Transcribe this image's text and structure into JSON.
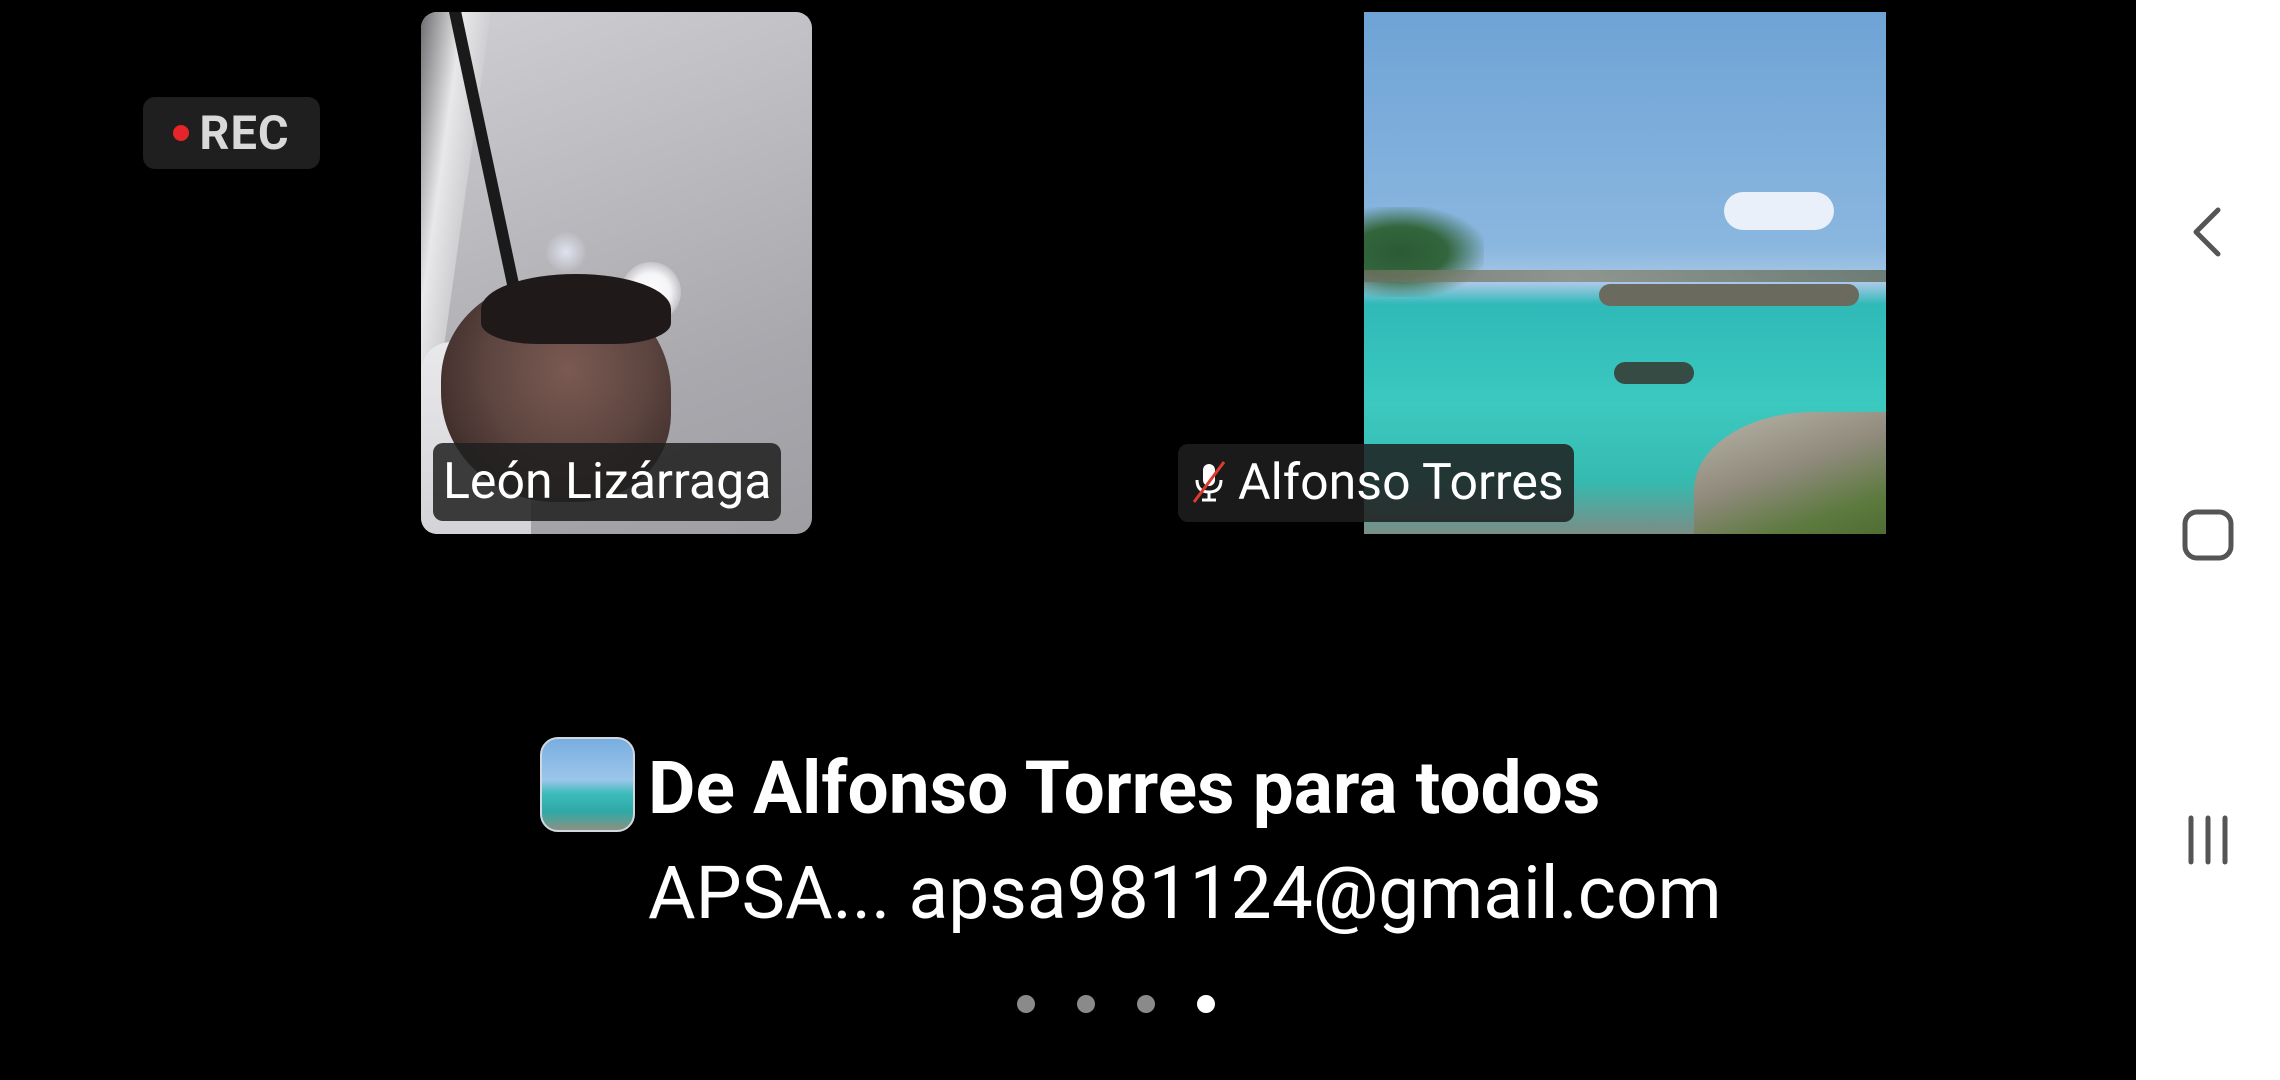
{
  "recording": {
    "label": "REC",
    "dot_color": "#e5252a"
  },
  "participants": [
    {
      "name": "León Lizárraga",
      "muted": false
    },
    {
      "name": "Alfonso Torres",
      "muted": true,
      "icon": "mic-muted-icon"
    }
  ],
  "chat_notification": {
    "title": "De Alfonso Torres para todos",
    "message": "APSA... apsa981124@gmail.com"
  },
  "pager": {
    "total": 4,
    "active_index": 3
  },
  "nav_bar": {
    "back_icon": "chevron-left-icon",
    "home_icon": "rounded-square-icon",
    "recents_icon": "three-bars-icon"
  }
}
